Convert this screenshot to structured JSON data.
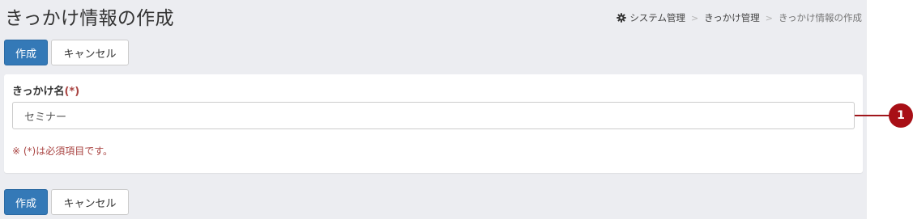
{
  "page": {
    "title": "きっかけ情報の作成"
  },
  "breadcrumb": {
    "icon": "gear-icon",
    "items": [
      "システム管理",
      "きっかけ管理",
      "きっかけ情報の作成"
    ],
    "separator": ">"
  },
  "toolbar": {
    "create_label": "作成",
    "cancel_label": "キャンセル"
  },
  "form": {
    "field_label": "きっかけ名",
    "required_mark": "(*)",
    "field_value": "セミナー",
    "note": "※ (*)は必須項目です。"
  },
  "callout": {
    "number": "1"
  },
  "colors": {
    "primary": "#3479b7",
    "required": "#a94442",
    "callout": "#a80f16",
    "background": "#ecedf1"
  }
}
